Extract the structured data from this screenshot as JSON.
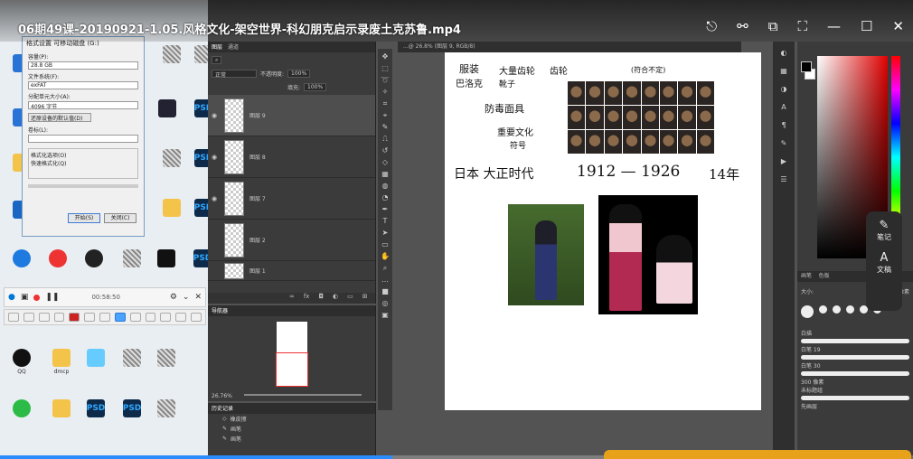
{
  "player": {
    "title": "06期49课-20190921-1.05.风格文化-架空世界-科幻朋克启示录废土克苏鲁.mp4",
    "progress": 0.43,
    "controls": [
      "share-icon",
      "link-icon",
      "picture-in-picture-icon",
      "fullscreen-icon",
      "minimize-icon",
      "maximize-icon",
      "close-icon"
    ]
  },
  "desktop": {
    "icons": [
      {
        "label": "",
        "kind": "ps"
      },
      {
        "label": "",
        "kind": "img"
      },
      {
        "label": "",
        "kind": "ps"
      },
      {
        "label": "",
        "kind": "img"
      },
      {
        "label": "",
        "kind": "fold"
      },
      {
        "label": "",
        "kind": "img"
      }
    ],
    "bottom_icons": [
      {
        "label": "QQ"
      },
      {
        "label": "dmcp"
      },
      {
        "label": ""
      },
      {
        "label": ""
      },
      {
        "label": ""
      }
    ]
  },
  "dialog": {
    "title": "格式设置 可移动磁盘 (G:)",
    "field1_label": "容量(P):",
    "field1_value": "28.8 GB",
    "field2_label": "文件系统(F):",
    "field2_value": "exFAT",
    "field3_label": "分配单元大小(A):",
    "field3_value": "4096 字节",
    "restore_button": "还原设备的默认值(D)",
    "volume_label": "卷标(L):",
    "volume_value": "",
    "format_options": "格式化选项(O)",
    "quick_format": "快速格式化(Q)",
    "start_button": "开始(S)",
    "close_button": "关闭(C)"
  },
  "recorder": {
    "timer": "00:58:50"
  },
  "photoshop": {
    "panel_tabs": [
      "图层",
      "通道"
    ],
    "blend_mode": "正常",
    "opacity_label": "不透明度:",
    "opacity_value": "100%",
    "fill_label": "填充:",
    "fill_value": "100%",
    "layers": [
      {
        "name": "图层 9",
        "active": true
      },
      {
        "name": "图层 8",
        "active": false
      },
      {
        "name": "图层 7",
        "active": false
      },
      {
        "name": "图层 2",
        "active": false
      },
      {
        "name": "图层 1",
        "active": false
      }
    ],
    "doc_tab": "...@ 26.8% (图层 9, RGB/8)",
    "navigator_title": "导航器",
    "zoom": "26.76%",
    "history_title": "历史记录",
    "history_items": [
      "橡皮擦",
      "画笔",
      "画笔"
    ],
    "brush_tabs": [
      "画笔",
      "色板"
    ],
    "brush_size_label": "大小:",
    "brush_size_value": "15 像素",
    "brush_group_1": "白描",
    "brush_group_2": "未标题组",
    "brush_labels": [
      "白笔 19",
      "白笔 30",
      "300 像素",
      "先画层"
    ]
  },
  "canvas_text": {
    "costume": "服装",
    "bazaar": "巴洛克",
    "big_inter": "大量齿轮",
    "gears": "齿轮",
    "shoes": "靴子",
    "mask": "防毒面具",
    "religion": "重要文化",
    "symbol": "符号",
    "note_paren": "(符合不定)",
    "era": "日本 大正时代",
    "years": "1912 — 1926",
    "span": "14年"
  },
  "side_notes": {
    "note_label": "笔记",
    "doc_label": "文稿"
  }
}
